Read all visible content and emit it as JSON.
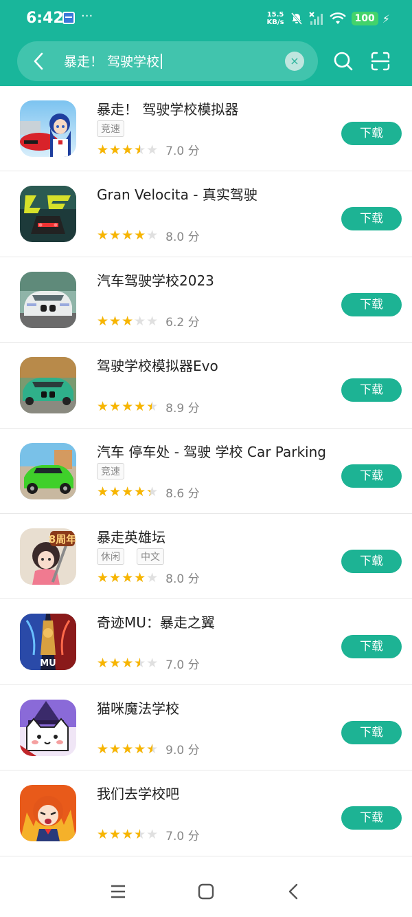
{
  "status": {
    "time": "6:42",
    "dots": "···",
    "net_speed_value": "15.5",
    "net_speed_unit": "KB/s",
    "battery": "100"
  },
  "search": {
    "query": "暴走！ 驾驶学校",
    "clear_symbol": "×"
  },
  "download_label": "下载",
  "score_suffix": "分",
  "apps": [
    {
      "title": "暴走！ 驾驶学校模拟器",
      "tags": [
        "竞速"
      ],
      "rating": 7.0,
      "rating_text": "7.0 分",
      "icon": "anime-girl-red-car"
    },
    {
      "title": "Gran Velocita - 真实驾驶",
      "tags": [],
      "rating": 8.0,
      "rating_text": "8.0 分",
      "icon": "gran-velocita-logo"
    },
    {
      "title": "汽车驾驶学校2023",
      "tags": [],
      "rating": 6.2,
      "rating_text": "6.2 分",
      "icon": "white-sports-car"
    },
    {
      "title": "驾驶学校模拟器Evo",
      "tags": [],
      "rating": 8.9,
      "rating_text": "8.9 分",
      "icon": "green-sports-car"
    },
    {
      "title": "汽车 停车处 - 驾驶 学校 Car Parking",
      "tags": [
        "竞速"
      ],
      "rating": 8.6,
      "rating_text": "8.6 分",
      "icon": "lime-green-car"
    },
    {
      "title": "暴走英雄坛",
      "tags": [
        "休闲",
        "中文"
      ],
      "rating": 8.0,
      "rating_text": "8.0 分",
      "icon": "wuxia-girl-8th-anniversary",
      "icon_badge": "8周年"
    },
    {
      "title": "奇迹MU：暴走之翼",
      "tags": [],
      "rating": 7.0,
      "rating_text": "7.0 分",
      "icon": "mu-winged-warrior",
      "icon_badge": "MU"
    },
    {
      "title": "猫咪魔法学校",
      "tags": [],
      "rating": 9.0,
      "rating_text": "9.0 分",
      "icon": "wizard-cat"
    },
    {
      "title": "我们去学校吧",
      "tags": [],
      "rating": 7.0,
      "rating_text": "7.0 分",
      "icon": "angry-anime-schoolgirl"
    }
  ],
  "colors": {
    "header": "#19b69b",
    "search_box": "#41c4ad",
    "download_button": "#1db394",
    "star": "#f7b500",
    "star_empty": "#e0e0e0"
  },
  "nav_icons": [
    "menu-icon",
    "home-icon",
    "back-icon"
  ]
}
